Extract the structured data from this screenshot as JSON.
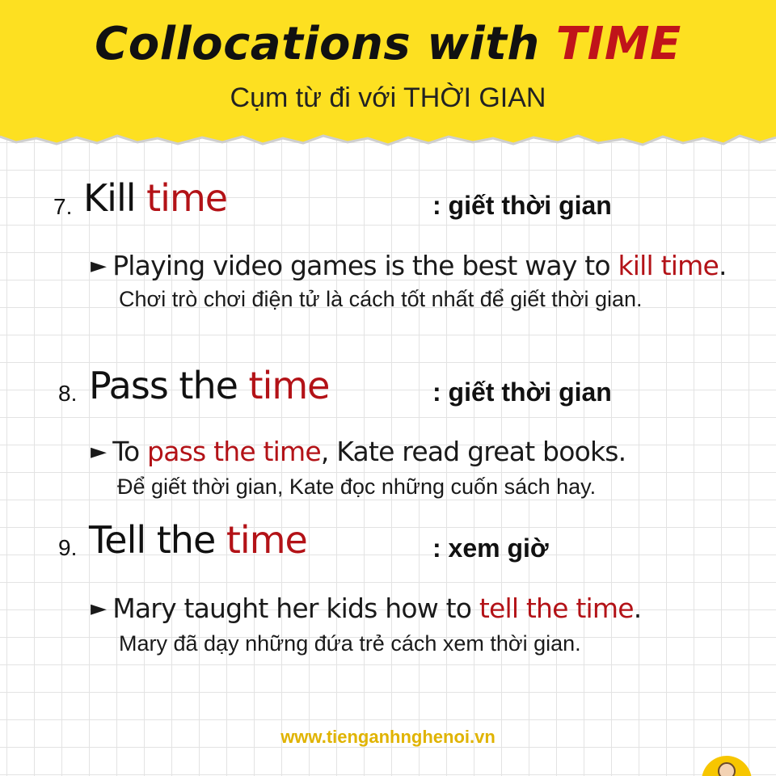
{
  "header": {
    "title_prefix": "Collocations with ",
    "title_highlight": "TIME",
    "subtitle": "Cụm từ đi với THỜI GIAN"
  },
  "entries": [
    {
      "number": "7.",
      "phrase_plain": "Kill ",
      "phrase_highlight": "time",
      "meaning": ": giết thời gian",
      "example_before": "Playing video games is the best way to ",
      "example_highlight": "kill time",
      "example_after": ".",
      "translation": "Chơi trò chơi điện tử là cách tốt nhất để giết thời gian."
    },
    {
      "number": "8.",
      "phrase_plain": "Pass the ",
      "phrase_highlight": "time",
      "meaning": ": giết thời gian",
      "example_before": "To ",
      "example_highlight": "pass the time",
      "example_after": ", Kate read great books.",
      "translation": "Để giết thời gian, Kate đọc những cuốn sách hay."
    },
    {
      "number": "9.",
      "phrase_plain": "Tell the ",
      "phrase_highlight": "time",
      "meaning": ": xem giờ",
      "example_before": "Mary taught her kids how to ",
      "example_highlight": "tell the time",
      "example_after": ".",
      "translation": "Mary đã dạy những đứa trẻ cách xem thời gian."
    }
  ],
  "bullet_glyph": "►",
  "footer": {
    "website": "www.tienganhnghenoi.vn"
  },
  "colors": {
    "banner": "#fde021",
    "highlight": "#b31217",
    "website": "#e0b300"
  }
}
